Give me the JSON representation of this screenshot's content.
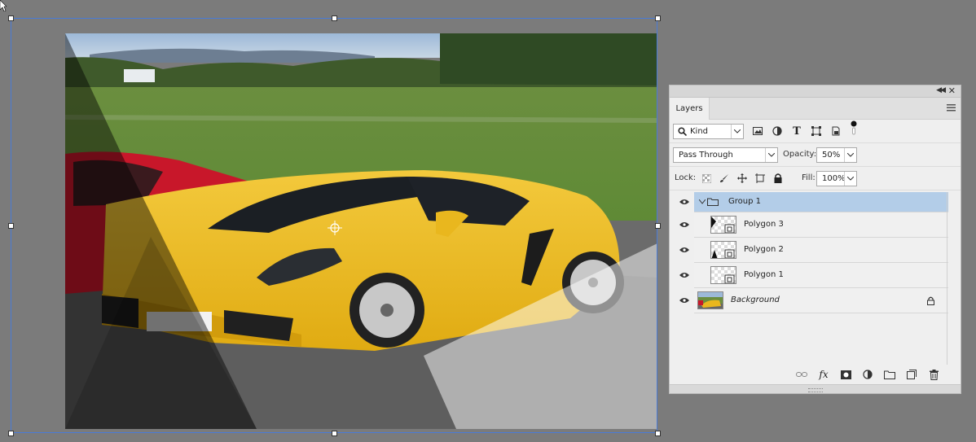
{
  "layers_panel": {
    "tab_label": "Layers",
    "filter": {
      "kind_label": "Kind"
    },
    "blend_mode": "Pass Through",
    "opacity_label": "Opacity:",
    "opacity_value": "50%",
    "lock_label": "Lock:",
    "fill_label": "Fill:",
    "fill_value": "100%",
    "layers": [
      {
        "name": "Group 1",
        "type": "group",
        "selected": true
      },
      {
        "name": "Polygon 3",
        "type": "shape"
      },
      {
        "name": "Polygon 2",
        "type": "shape"
      },
      {
        "name": "Polygon 1",
        "type": "shape"
      },
      {
        "name": "Background",
        "type": "image",
        "locked": true
      }
    ],
    "bottom_icons": [
      "link-icon",
      "fx-icon",
      "mask-icon",
      "adjustment-icon",
      "folder-icon",
      "new-layer-icon",
      "trash-icon"
    ]
  },
  "colors": {
    "selection_highlight": "#b3cde8",
    "transform_box": "#4a7bd6",
    "workspace": "#7b7b7b"
  }
}
